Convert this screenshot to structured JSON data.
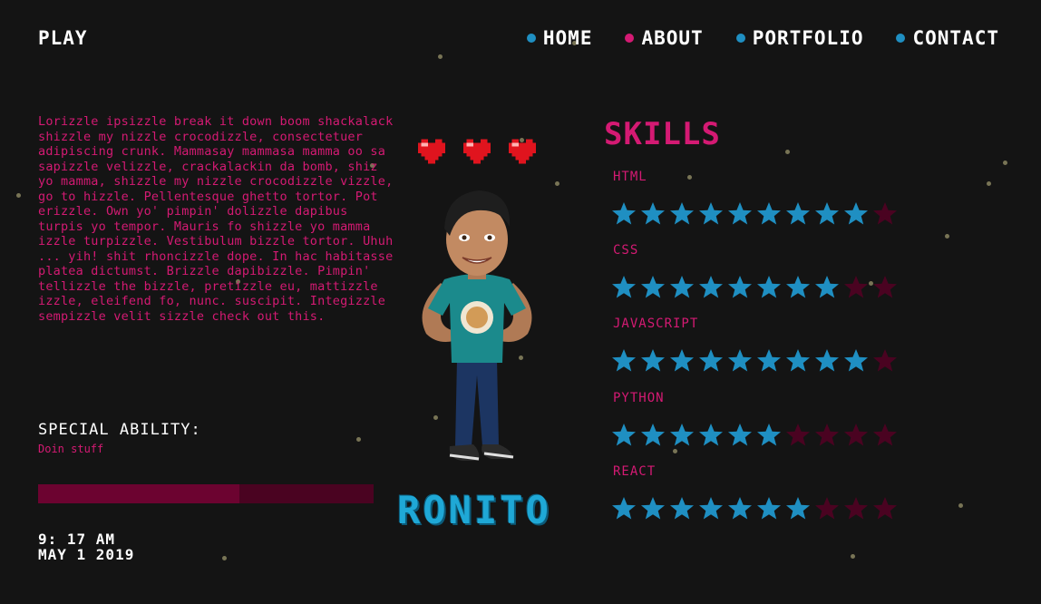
{
  "header": {
    "brand": "PLAY",
    "nav": [
      {
        "label": "HOME",
        "color": "#1f8fc2"
      },
      {
        "label": "ABOUT",
        "color": "#d41a73"
      },
      {
        "label": "PORTFOLIO",
        "color": "#1f8fc2"
      },
      {
        "label": "CONTACT",
        "color": "#1f8fc2"
      }
    ]
  },
  "bio": "Lorizzle ipsizzle break it down boom shackalack shizzle my nizzle crocodizzle, consectetuer adipiscing crunk. Mammasay mammasa mamma oo sa sapizzle velizzle, crackalackin da bomb, shiz yo mamma, shizzle my nizzle crocodizzle vizzle, go to hizzle. Pellentesque ghetto tortor. Pot erizzle. Own yo' pimpin' dolizzle dapibus turpis yo tempor. Mauris fo shizzle yo mamma izzle turpizzle. Vestibulum bizzle tortor. Uhuh ... yih! shit rhoncizzle dope. In hac habitasse platea dictumst. Brizzle dapibizzle. Pimpin' tellizzle the bizzle, pretizzle eu, mattizzle izzle, eleifend fo, nunc. suscipit. Integizzle sempizzle velit sizzle check out this.",
  "ability": {
    "title": "SPECIAL ABILITY:",
    "value": "Doin stuff",
    "level": 0.6
  },
  "clock": {
    "time": "9: 17 AM",
    "date": "MAY 1 2019"
  },
  "character": {
    "name": "RONITO",
    "hearts": 3
  },
  "skills": {
    "title": "SKILLS",
    "max": 10,
    "items": [
      {
        "label": "HTML",
        "rating": 9
      },
      {
        "label": "CSS",
        "rating": 8
      },
      {
        "label": "JAVASCRIPT",
        "rating": 9
      },
      {
        "label": "PYTHON",
        "rating": 6
      },
      {
        "label": "REACT",
        "rating": 7
      }
    ]
  },
  "colors": {
    "accent_pink": "#d41a73",
    "accent_blue": "#1f8fc2",
    "star_on": "#1f8fc2",
    "star_off": "#4a0321",
    "background": "#141414"
  },
  "icons": {
    "heart": "heart-icon",
    "star": "star-icon"
  }
}
